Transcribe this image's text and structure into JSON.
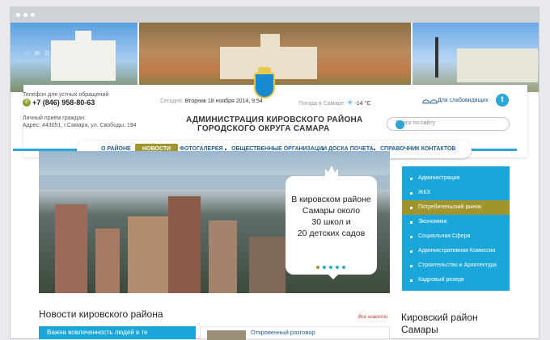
{
  "header": {
    "phone_label": "Телефон для устных обращений",
    "phone": "+7 (846) 958-80-63",
    "reception_label": "Личный приём граждан:",
    "address": "Адрес: 443051, г.Самара, ул. Свободы, 194",
    "date_label": "Сегодня:",
    "date_value": "Вторник 18 ноября 2014, 9:54",
    "weather_label": "Погода в Самаре:",
    "weather_value": "-14 °C",
    "title_line1": "АДМИНИСТРАЦИЯ КИРОВСКОГО РАЙОНА",
    "title_line2": "ГОРОДСКОГО ОКРУГА САМАРА",
    "visually_impaired": "Для слабовидящих",
    "search_placeholder": "Поиск по сайту"
  },
  "nav": [
    {
      "label": "О РАЙОНЕ",
      "active": false
    },
    {
      "label": "НОВОСТИ",
      "active": true
    },
    {
      "label": "ФОТОГАЛЕРЕЯ",
      "active": false
    },
    {
      "label": "ОБЩЕСТВЕННЫЕ ОРГАНИЗАЦИИ",
      "active": false
    },
    {
      "label": "ДОСКА ПОЧЕТА",
      "active": false
    },
    {
      "label": "СПРАВОЧНИК КОНТАКТОВ",
      "active": false
    }
  ],
  "hero": {
    "text": [
      "В кировском районе",
      "Самары около",
      "30 школ и",
      "20 детских садов"
    ],
    "active_slide": 1,
    "slides": 5
  },
  "sidebar": [
    {
      "label": "Администрация",
      "active": false
    },
    {
      "label": "ЖКХ",
      "active": false
    },
    {
      "label": "Потребительский рынок",
      "active": true
    },
    {
      "label": "Экономика",
      "active": false
    },
    {
      "label": "Социальная Сфера",
      "active": false
    },
    {
      "label": "Административная Комиссия",
      "active": false
    },
    {
      "label": "Строительство и Архитектура",
      "active": false
    },
    {
      "label": "Кадровый резерв",
      "active": false
    }
  ],
  "news": {
    "heading": "Новости кировского района",
    "all_link": "Все новости",
    "card1_title": "Важна вовлеченность людей в те",
    "card2_title": "Откровенный разговор"
  },
  "district": {
    "line1": "Кировский район",
    "line2": "Самары"
  },
  "colors": {
    "accent": "#1aa6d9",
    "active": "#a0952c",
    "link": "#1d5b8d"
  }
}
